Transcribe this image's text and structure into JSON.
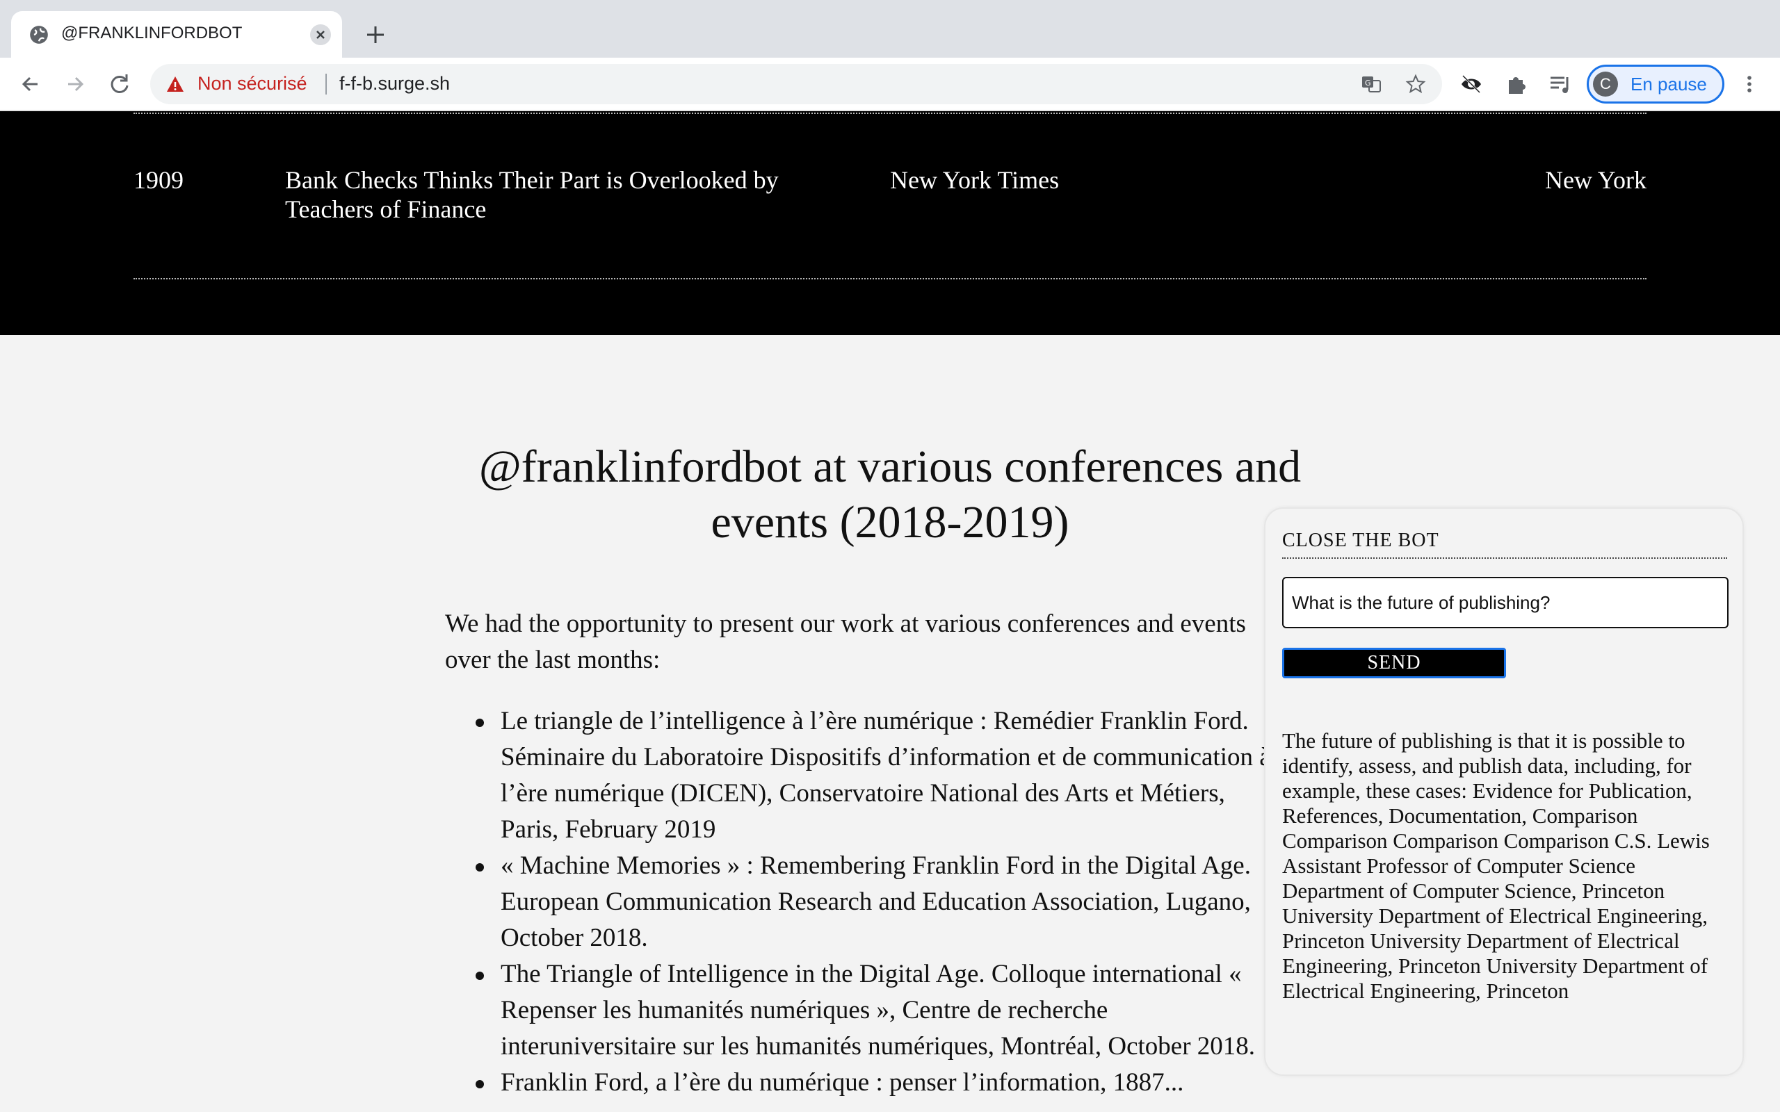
{
  "browser": {
    "tab_title": "@FRANKLINFORDBOT",
    "security_label": "Non sécurisé",
    "url": "f-f-b.surge.sh",
    "profile_initial": "C",
    "profile_label": "En pause"
  },
  "table_row": {
    "year": "1909",
    "title": "Bank Checks Thinks Their Part is Overlooked by Teachers of Finance",
    "source": "New York Times",
    "place": "New York"
  },
  "article": {
    "heading": "@franklinfordbot at various conferences and events (2018-2019)",
    "intro": "We had the opportunity to present our work at various conferences and events over the last months:",
    "events": [
      "Le triangle de l’intelligence à l’ère numérique : Remédier Franklin Ford. Séminaire du Laboratoire Dispositifs d’information et de communication à l’ère numérique (DICEN), Conservatoire National des Arts et Métiers, Paris, February 2019",
      "« Machine Memories » : Remembering Franklin Ford in the Digital Age. European Communication Research and Education Association, Lugano, October 2018.",
      "The Triangle of Intelligence in the Digital Age. Colloque international « Repenser les humanités numériques », Centre de recherche interuniversitaire sur les humanités numériques, Montréal, October 2018.",
      "Franklin Ford, a l’ère du numérique : penser l’information, 1887..."
    ]
  },
  "bot": {
    "close_label": "CLOSE THE BOT",
    "input_value": "What is the future of publishing?",
    "send_label": "SEND",
    "reply": "The future of publishing is that it is possible to identify, assess, and publish data, including, for example, these cases: Evidence for Publication, References, Documentation, Comparison Comparison Comparison Comparison C.S. Lewis Assistant Professor of Computer Science Department of Computer Science, Princeton University Department of Electrical Engineering, Princeton University Department of Electrical Engineering, Princeton University Department of Electrical Engineering, Princeton"
  }
}
